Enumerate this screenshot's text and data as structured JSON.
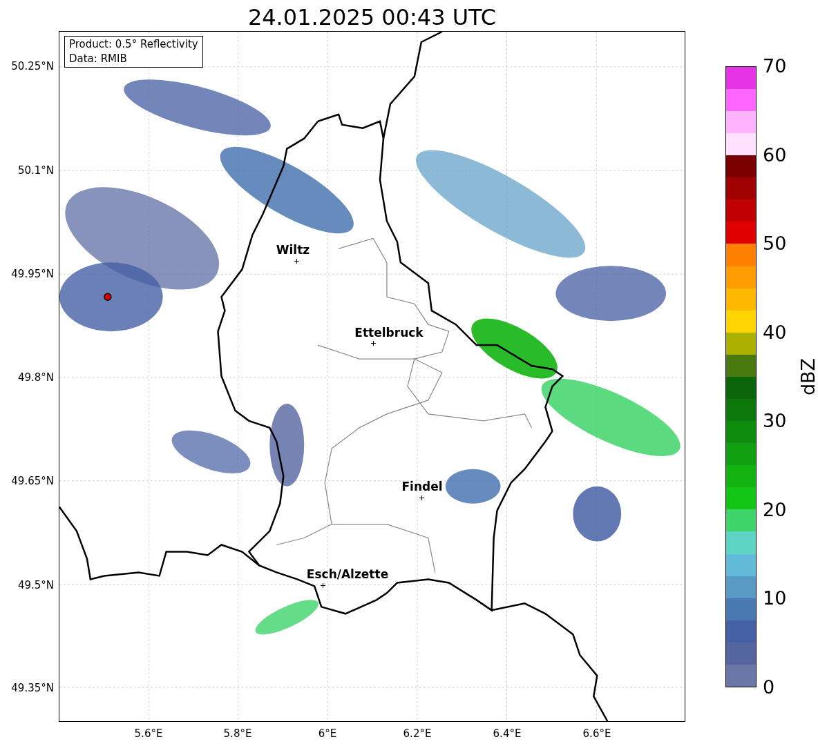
{
  "title": "24.01.2025 00:43 UTC",
  "info_box": [
    "Product: 0.5° Reflectivity",
    "Data: RMIB"
  ],
  "map": {
    "lat_ticks": [
      "50.25°N",
      "50.1°N",
      "49.95°N",
      "49.8°N",
      "49.65°N",
      "49.5°N",
      "49.35°N"
    ],
    "lon_ticks": [
      "5.6°E",
      "5.8°E",
      "6°E",
      "6.2°E",
      "6.4°E",
      "6.6°E"
    ],
    "cities": [
      {
        "name": "Wiltz"
      },
      {
        "name": "Ettelbruck"
      },
      {
        "name": "Findel"
      },
      {
        "name": "Esch/Alzette"
      }
    ]
  },
  "colorbar": {
    "label": "dBZ",
    "ticks": [
      "70",
      "60",
      "50",
      "40",
      "30",
      "20",
      "10",
      "0"
    ],
    "segments": [
      {
        "color": "#6a78a8"
      },
      {
        "color": "#5565a0"
      },
      {
        "color": "#4560a5"
      },
      {
        "color": "#4a78b0"
      },
      {
        "color": "#5a9bc5"
      },
      {
        "color": "#62bad9"
      },
      {
        "color": "#5dd4c4"
      },
      {
        "color": "#3ed46a"
      },
      {
        "color": "#14c614"
      },
      {
        "color": "#12b412"
      },
      {
        "color": "#10a010"
      },
      {
        "color": "#0e8c0e"
      },
      {
        "color": "#0c780c"
      },
      {
        "color": "#0a640a"
      },
      {
        "color": "#487a10"
      },
      {
        "color": "#acb000"
      },
      {
        "color": "#ffd500"
      },
      {
        "color": "#ffb800"
      },
      {
        "color": "#ff9c00"
      },
      {
        "color": "#ff7f00"
      },
      {
        "color": "#e00000"
      },
      {
        "color": "#c00000"
      },
      {
        "color": "#a00000"
      },
      {
        "color": "#7a0000"
      },
      {
        "color": "#ffe0ff"
      },
      {
        "color": "#ffb3ff"
      },
      {
        "color": "#ff66ff"
      },
      {
        "color": "#e633e6"
      }
    ]
  }
}
